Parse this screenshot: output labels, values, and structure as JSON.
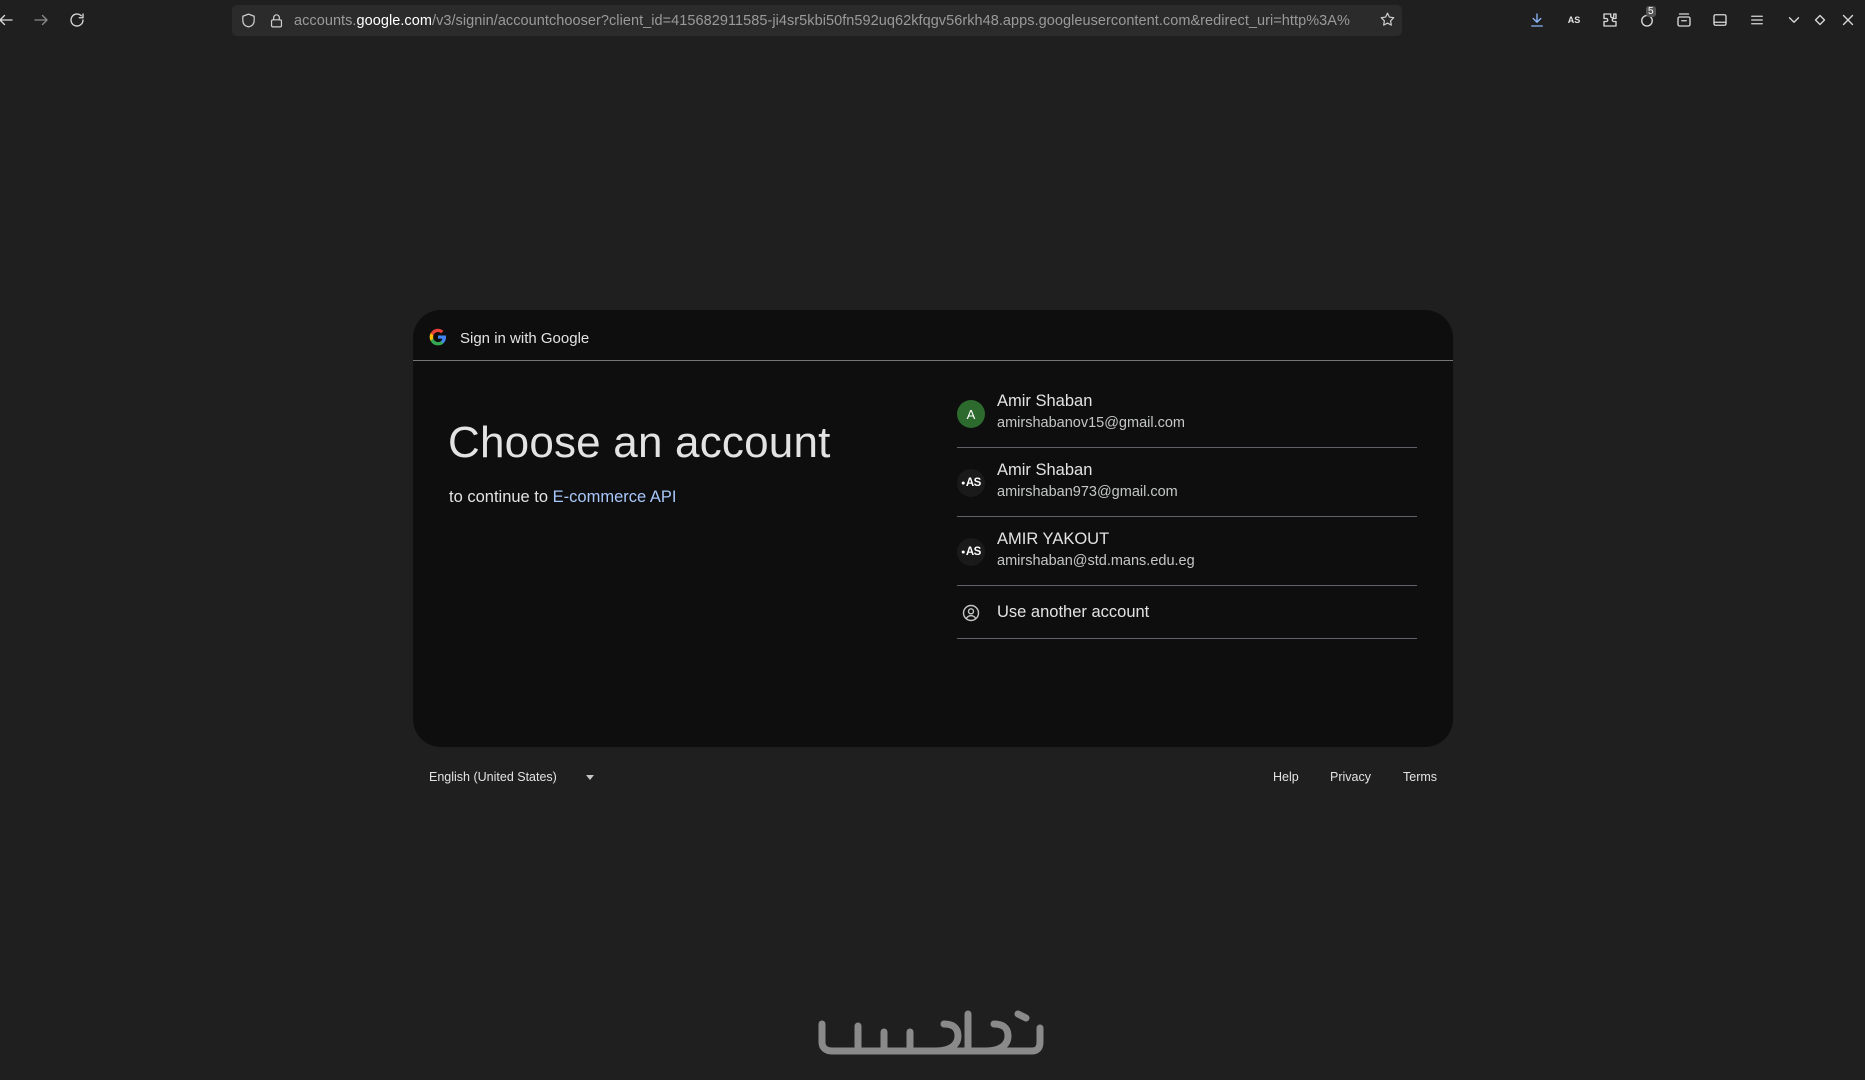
{
  "browser": {
    "url_prefix": "accounts.",
    "url_host": "google.com",
    "url_rest": "/v3/signin/accountchooser?client_id=415682911585-ji4sr5kbi50fn592uq62kfqgv56rkh48.apps.googleusercontent.com&redirect_uri=http%3A%",
    "extension_avatar_text": "AS",
    "extension_badge_count": "5",
    "icons": [
      "back-icon",
      "forward-icon",
      "reload-icon",
      "shield-icon",
      "lock-icon",
      "bookmark-star-icon",
      "download-icon",
      "profile-extension-icon",
      "extensions-puzzle-icon",
      "extension-badge-icon",
      "container-icon",
      "sidebar-icon",
      "menu-icon",
      "list-all-tabs-icon",
      "minimize-icon",
      "close-icon"
    ]
  },
  "card": {
    "header_title": "Sign in with Google",
    "heading": "Choose an account",
    "subtitle_prefix": "to continue to",
    "app_name": "E-commerce API",
    "accounts": [
      {
        "avatar": "A",
        "avatar_color": "#2d6a2e",
        "name": "Amir Shaban",
        "email": "amirshabanov15@gmail.com"
      },
      {
        "avatar": "AS",
        "avatar_color": "#1a1a1a",
        "name": "Amir Shaban",
        "email": "amirshaban973@gmail.com"
      },
      {
        "avatar": "AS",
        "avatar_color": "#1a1a1a",
        "name": "AMIR YAKOUT",
        "email": "amirshaban@std.mans.edu.eg"
      }
    ],
    "use_another": "Use another account"
  },
  "footer": {
    "language": "English (United States)",
    "help": "Help",
    "privacy": "Privacy",
    "terms": "Terms"
  },
  "colors": {
    "page_bg": "#1f1f1f",
    "card_bg": "#0e0e0e",
    "link": "#a8c7fa"
  }
}
